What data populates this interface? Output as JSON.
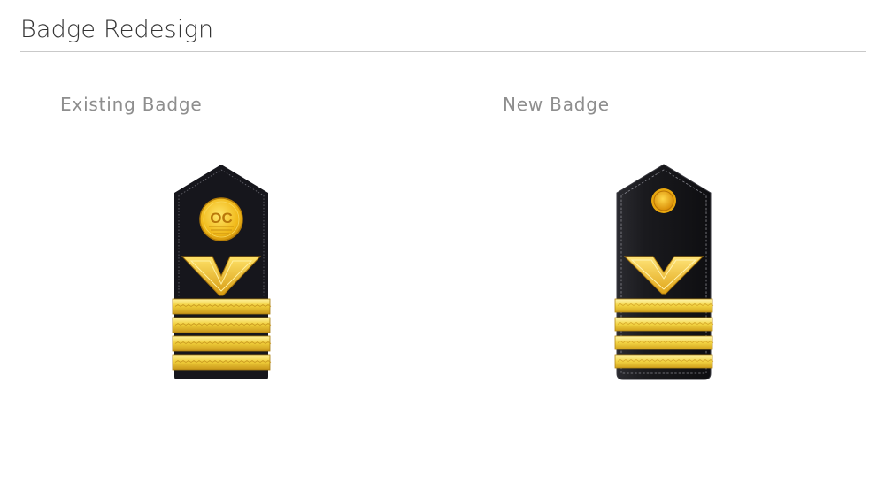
{
  "header": {
    "title": "Badge Redesign"
  },
  "sections": [
    {
      "label": "Existing Badge",
      "emblem_text": "OC"
    },
    {
      "label": "New Badge"
    }
  ],
  "colors": {
    "board": "#141418",
    "gold_light": "#f6e27a",
    "gold_mid": "#e8b820",
    "gold_dark": "#b8860b",
    "title_text": "#333333",
    "label_text": "#8e8e8e"
  }
}
